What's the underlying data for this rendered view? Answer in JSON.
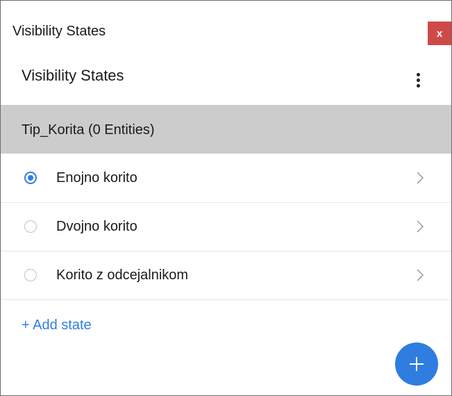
{
  "window": {
    "title": "Visibility States",
    "close_label": "x"
  },
  "header": {
    "title": "Visibility States",
    "more_icon": "more-vertical-icon"
  },
  "group": {
    "label": "Tip_Korita (0 Entities)"
  },
  "states": [
    {
      "label": "Enojno korito",
      "selected": true
    },
    {
      "label": "Dvojno korito",
      "selected": false
    },
    {
      "label": "Korito z odcejalnikom",
      "selected": false
    }
  ],
  "actions": {
    "add_state_label": "+ Add state",
    "fab_icon": "plus-icon"
  },
  "colors": {
    "accent": "#2f7de1",
    "close": "#cf4949",
    "group_bg": "#cccccc"
  }
}
